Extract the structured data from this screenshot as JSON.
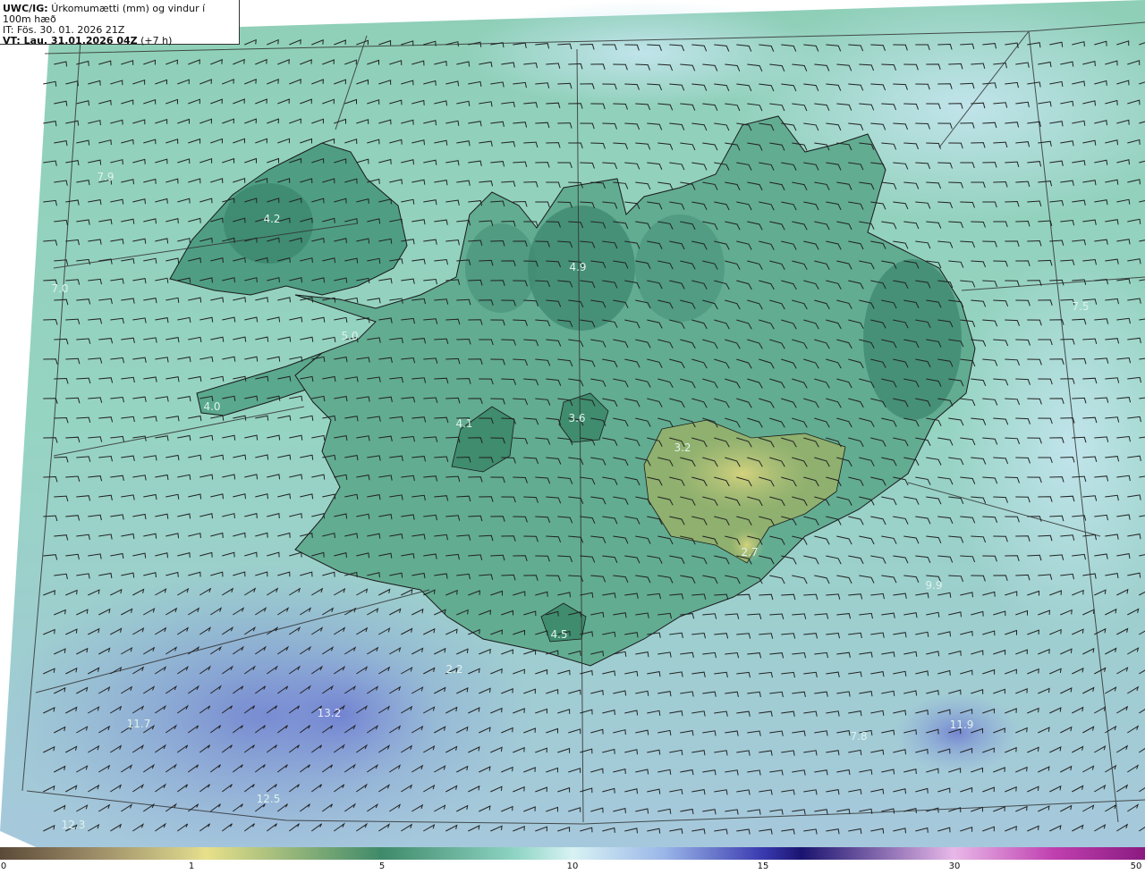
{
  "header": {
    "model_label": "UWC/IG:",
    "title": "Úrkomumætti (mm) og vindur í 100m hæð",
    "it_line": "IT: Fös. 30. 01. 2026 21Z",
    "vt_label": "VT: Lau. 31.01.2026 04Z",
    "vt_suffix": "(+7 h)"
  },
  "colors": {
    "ocean": "#8fd0c0",
    "land": "#4f9e84",
    "land_dark": "#2f7a62",
    "glacier_yellow": "#c8cc7a",
    "south_blue": "#8ea6dc",
    "deep_blue": "#5a62c0",
    "coast": "#1a1a1a",
    "grid": "#333333"
  },
  "map_labels": [
    {
      "text": "7.9"
    },
    {
      "text": "4.2"
    },
    {
      "text": "7.0"
    },
    {
      "text": "5.0"
    },
    {
      "text": "4.0"
    },
    {
      "text": "4.9"
    },
    {
      "text": "4.1"
    },
    {
      "text": "3.6"
    },
    {
      "text": "3.2"
    },
    {
      "text": "2.7"
    },
    {
      "text": "4.5"
    },
    {
      "text": "7.5"
    },
    {
      "text": "9.9"
    },
    {
      "text": "2.2"
    },
    {
      "text": "13.2"
    },
    {
      "text": "11.7"
    },
    {
      "text": "12.5"
    },
    {
      "text": "12.3"
    },
    {
      "text": "7.8"
    },
    {
      "text": "11.9"
    }
  ],
  "colorbar": {
    "ticks": [
      "0",
      "1",
      "5",
      "10",
      "15",
      "30",
      "50"
    ]
  }
}
